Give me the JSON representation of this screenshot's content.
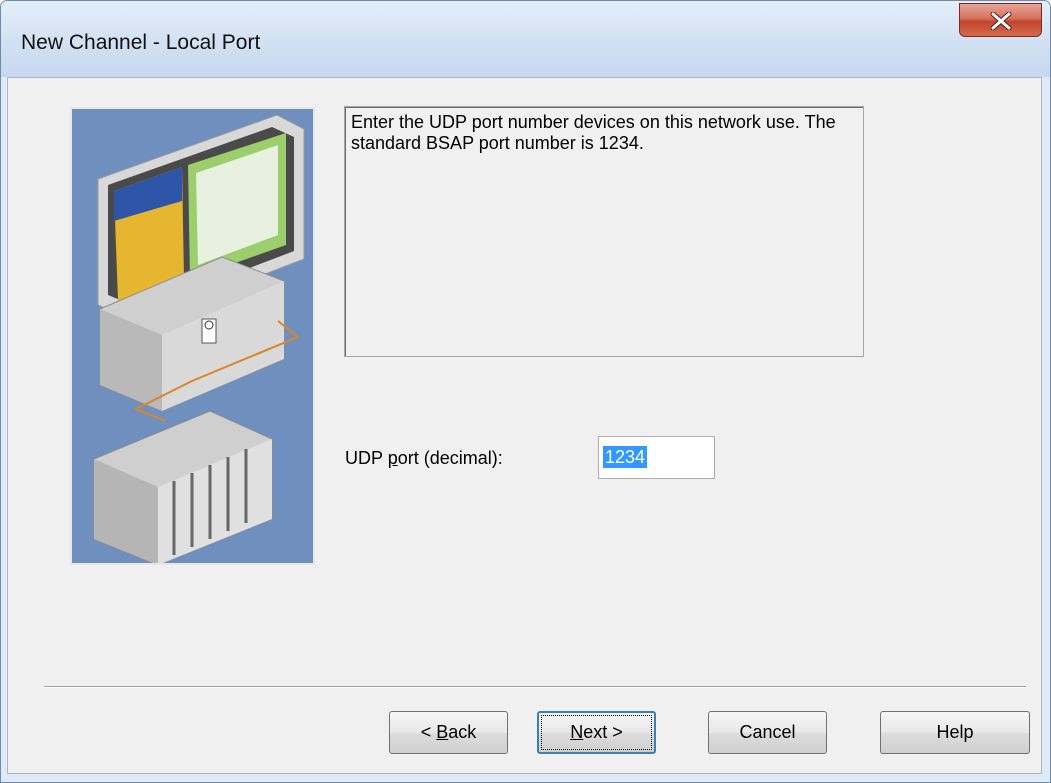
{
  "window": {
    "title": "New Channel - Local Port"
  },
  "description": {
    "text": "Enter the UDP port number devices on this network use. The standard BSAP port number is 1234."
  },
  "udp_port": {
    "label_pre": "UDP ",
    "label_mnemonic": "p",
    "label_post": "ort (decimal):",
    "value": "1234"
  },
  "buttons": {
    "back": {
      "pre": "< ",
      "mnemonic": "B",
      "post": "ack"
    },
    "next": {
      "pre": "",
      "mnemonic": "N",
      "post": "ext >"
    },
    "cancel": "Cancel",
    "help": "Help"
  },
  "colors": {
    "close_button": "#c7452d",
    "selection": "#3399ff",
    "illustration_bg": "#6f8fbf"
  },
  "icons": {
    "close": "close-icon",
    "illustration": "computer-network-plc-illustration"
  }
}
